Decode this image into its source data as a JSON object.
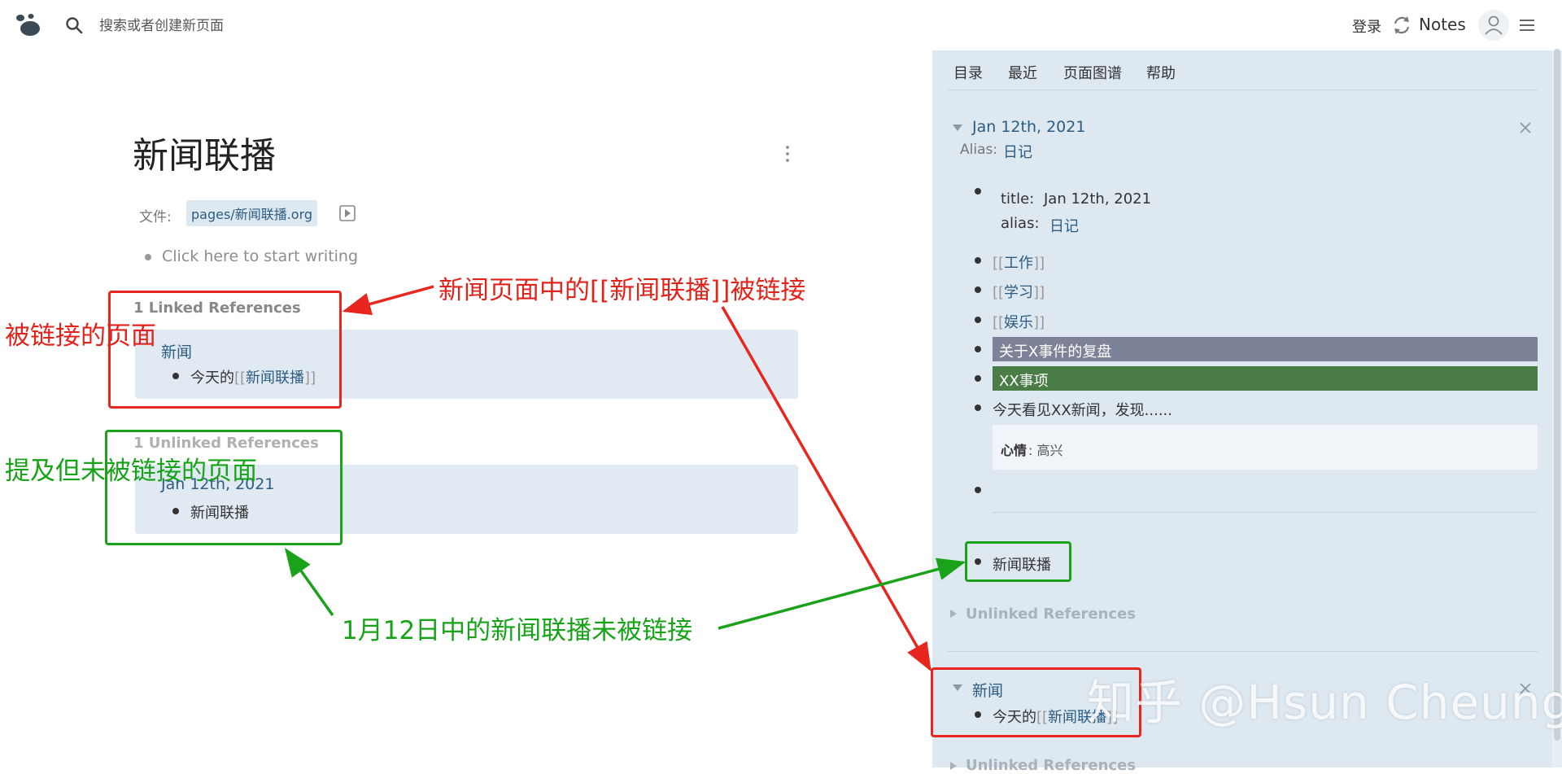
{
  "topbar": {
    "search_placeholder": "搜索或者创建新页面",
    "login_label": "登录",
    "notes_label": "Notes"
  },
  "page": {
    "title": "新闻联播",
    "file_label": "文件:",
    "file_path": "pages/新闻联播.org",
    "placeholder": "Click here to start writing",
    "linked_header": "1 Linked References",
    "linked_page": "新闻",
    "linked_text_prefix": "今天的",
    "linked_text_link": "新闻联播",
    "unlinked_header": "1 Unlinked References",
    "unlinked_page": "Jan 12th, 2021",
    "unlinked_text": "新闻联播"
  },
  "sidebar": {
    "tabs": [
      "目录",
      "最近",
      "页面图谱",
      "帮助"
    ],
    "card1": {
      "title": "Jan 12th, 2021",
      "alias_label": "Alias:",
      "alias_value": "日记",
      "prop_title_key": "title:",
      "prop_title_val": "Jan 12th, 2021",
      "prop_alias_key": "alias:",
      "prop_alias_val": "日记",
      "link_items": [
        "工作",
        "学习",
        "娱乐"
      ],
      "highlight_gray": "关于X事件的复盘",
      "highlight_green": "XX事项",
      "text_item": "今天看见XX新闻，发现......",
      "mood_key": "心情",
      "mood_val": ": 高兴",
      "mention_item": "新闻联播",
      "unlinked_label": "Unlinked References"
    },
    "card2": {
      "title": "新闻",
      "text_prefix": "今天的",
      "text_link": "新闻联播",
      "unlinked_label": "Unlinked References"
    }
  },
  "annotations": {
    "top_red": "新闻页面中的[[新闻联播]]被链接",
    "left_red": "被链接的页面",
    "left_green": "提及但未被链接的页面",
    "bottom_green": "1月12日中的新闻联播未被链接"
  },
  "watermark": "知乎 @Hsun Cheung",
  "colors": {
    "link": "#2c5c82",
    "sidebar_bg": "#dde8f1",
    "annotation_red": "#e8261f",
    "annotation_green": "#1ba21b",
    "highlight_gray": "#7e8298",
    "highlight_green": "#4a7c45"
  }
}
